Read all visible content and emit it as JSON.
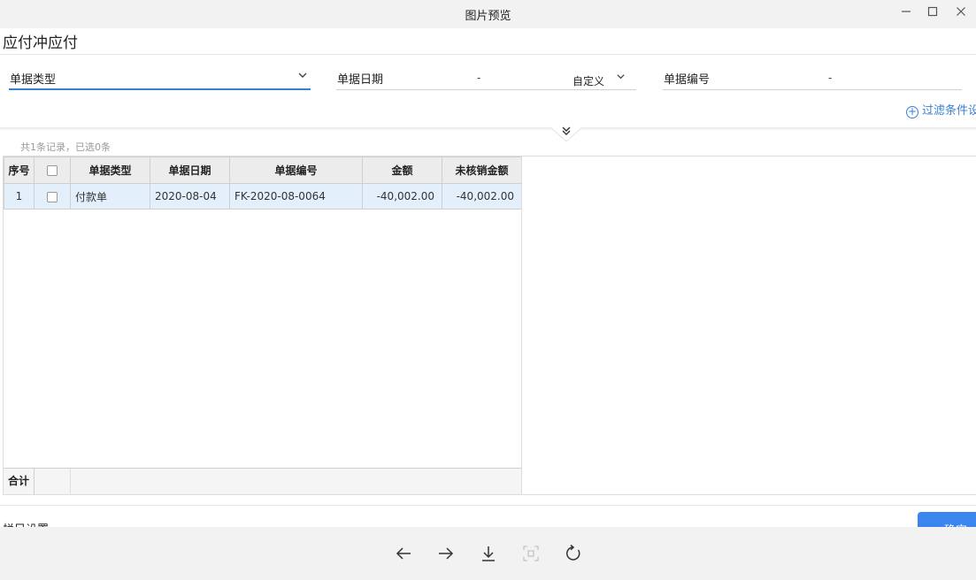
{
  "window": {
    "title": "图片预览",
    "min_icon": "minimize-icon",
    "max_icon": "maximize-icon",
    "close_icon": "close-icon"
  },
  "page": {
    "title": "应付冲应付"
  },
  "filters": {
    "doc_type": {
      "label": "单据类型",
      "icon": "chevron-down-icon"
    },
    "doc_date": {
      "label": "单据日期",
      "separator": "-",
      "range_option": "自定义",
      "icon": "chevron-down-icon"
    },
    "doc_no": {
      "label": "单据编号",
      "separator": "-"
    },
    "add_filter": {
      "label": "过滤条件设置",
      "icon": "plus-circle-icon"
    },
    "expand_icon": "double-chevron-down-icon"
  },
  "records": {
    "summary": "共1条记录，已选0条"
  },
  "table": {
    "headers": [
      "序号",
      "",
      "单据类型",
      "单据日期",
      "单据编号",
      "金额",
      "未核销金额"
    ],
    "rows": [
      {
        "index": "1",
        "type": "付款单",
        "date": "2020-08-04",
        "number": "FK-2020-08-0064",
        "amount": "-40,002.00",
        "unsettled": "-40,002.00"
      }
    ],
    "total_label": "合计"
  },
  "footer": {
    "column_settings": "栏目设置",
    "confirm": "确定"
  },
  "toolbar": {
    "icons": [
      "arrow-left-icon",
      "arrow-right-icon",
      "download-icon",
      "fit-screen-icon",
      "rotate-icon"
    ]
  },
  "colors": {
    "accent": "#3a7fd5",
    "negative": "#e0192b",
    "row_selected": "#e4effc"
  }
}
